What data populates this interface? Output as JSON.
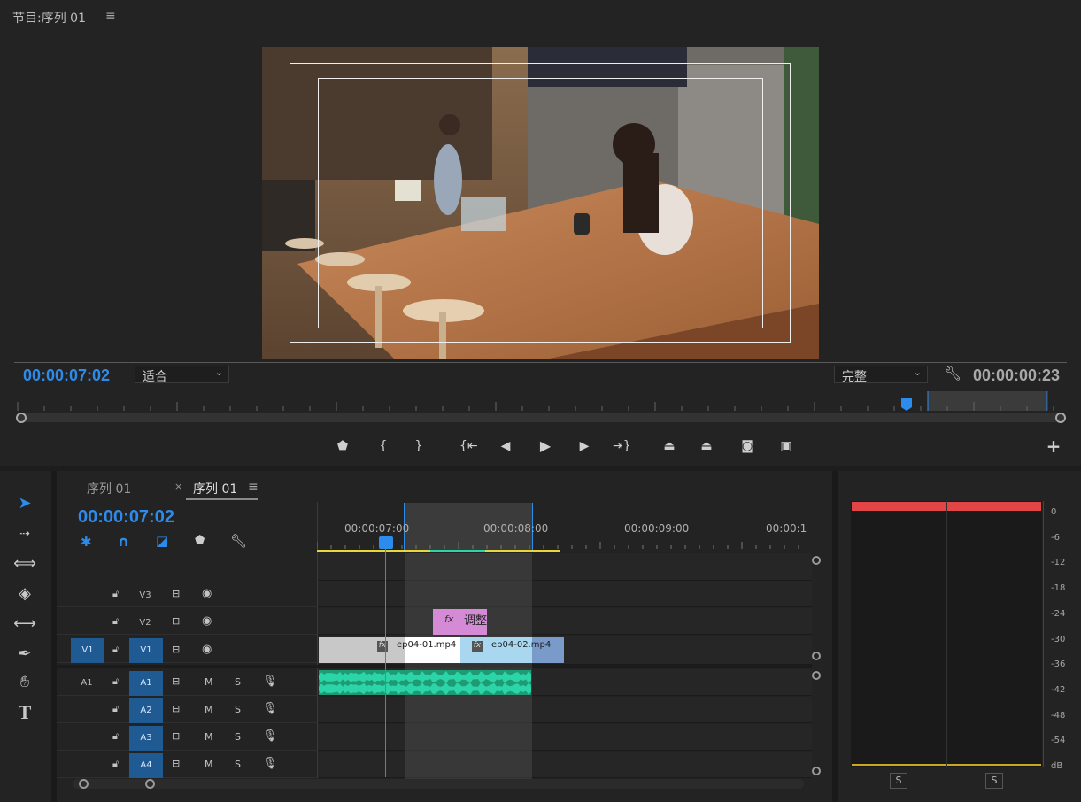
{
  "program": {
    "title": "节目:序列 01",
    "menu_icon": "≡",
    "timecode_current": "00:00:07:02",
    "fit_select": "适合",
    "quality_select": "完整",
    "timecode_duration": "00:00:00:23"
  },
  "transport": {
    "icons": [
      "marker-icon",
      "mark-in-icon",
      "mark-out-icon",
      "go-to-in-icon",
      "step-back-icon",
      "play-icon",
      "step-forward-icon",
      "go-to-out-icon",
      "lift-icon",
      "extract-icon",
      "export-frame-icon",
      "compare-icon",
      "add-button-icon"
    ]
  },
  "tools": [
    "selection-tool-icon",
    "track-select-tool-icon",
    "ripple-edit-tool-icon",
    "razor-tool-icon",
    "slip-tool-icon",
    "pen-tool-icon",
    "hand-tool-icon",
    "type-tool-icon"
  ],
  "timeline": {
    "tabs": [
      {
        "label": "序列 01"
      },
      {
        "label": "序列 01"
      }
    ],
    "tab_close": "×",
    "tab_menu": "≡",
    "timecode": "00:00:07:02",
    "ruler": [
      "00:00:07:00",
      "00:00:08:00",
      "00:00:09:00",
      "00:00:1"
    ],
    "tracks": {
      "video": [
        {
          "name": "V3",
          "source": ""
        },
        {
          "name": "V2",
          "source": ""
        },
        {
          "name": "V1",
          "source": "V1"
        }
      ],
      "audio": [
        {
          "name": "A1",
          "source": "A1"
        },
        {
          "name": "A2",
          "source": ""
        },
        {
          "name": "A3",
          "source": ""
        },
        {
          "name": "A4",
          "source": ""
        }
      ],
      "mute_label": "M",
      "solo_label": "S"
    },
    "clips": {
      "adjust": {
        "fx": "fx",
        "label": "调整"
      },
      "clip1": {
        "fx": "fx",
        "label": "ep04-01.mp4"
      },
      "clip2": {
        "fx": "fx",
        "label": "ep04-02.mp4"
      }
    }
  },
  "audio_meter": {
    "scale": [
      "0",
      "-6",
      "-12",
      "-18",
      "-24",
      "-30",
      "-36",
      "-42",
      "-48",
      "-54",
      "dB"
    ],
    "solo_left": "S",
    "solo_right": "S"
  },
  "colors": {
    "accent_blue": "#2d8ceb",
    "target_blue": "#1f5a93",
    "adjust_clip": "#d58ad6",
    "audio_wave": "#2bd5a8",
    "peak_red": "#e24545",
    "work_area_yellow": "#e8d73a"
  }
}
